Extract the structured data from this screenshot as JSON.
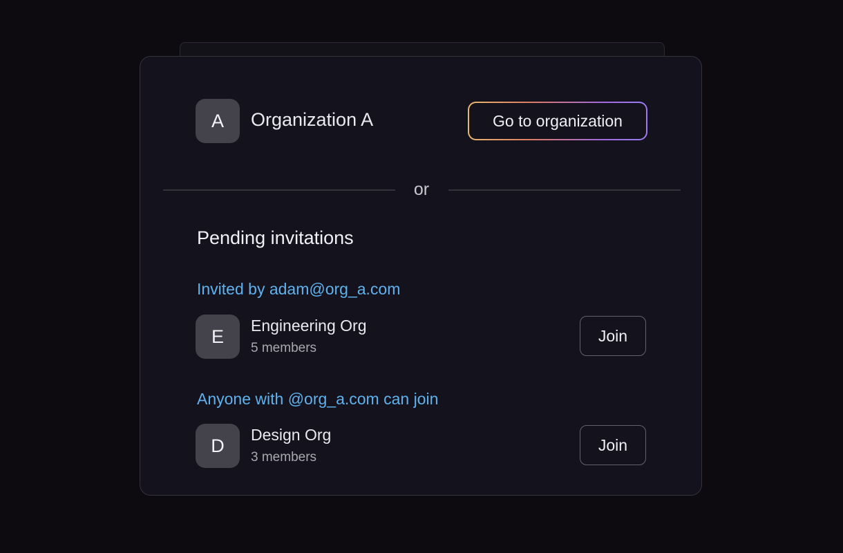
{
  "current_org": {
    "initial": "A",
    "name": "Organization A",
    "action_label": "Go to organization"
  },
  "divider": {
    "label": "or"
  },
  "pending": {
    "title": "Pending invitations",
    "items": [
      {
        "note": "Invited by adam@org_a.com",
        "initial": "E",
        "name": "Engineering Org",
        "members": "5 members",
        "action_label": "Join"
      },
      {
        "note": "Anyone with @org_a.com can join",
        "initial": "D",
        "name": "Design Org",
        "members": "3 members",
        "action_label": "Join"
      }
    ]
  },
  "colors": {
    "background": "#0d0b10",
    "card": "#14131d",
    "accent_link": "#5fb2ee",
    "gradient_border": [
      "#e8b86c",
      "#df7a63",
      "#a06adf",
      "#9a7cf4"
    ]
  }
}
